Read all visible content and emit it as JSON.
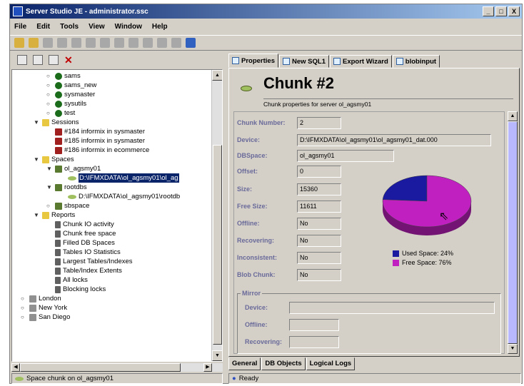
{
  "window": {
    "title": "Server Studio JE - administrator.ssc",
    "buttons": [
      "_",
      "□",
      "X"
    ]
  },
  "menu": [
    "File",
    "Edit",
    "Tools",
    "View",
    "Window",
    "Help"
  ],
  "tree": {
    "items": [
      {
        "label": "sams",
        "icon": "db-icon",
        "indent": 3
      },
      {
        "label": "sams_new",
        "icon": "db-icon",
        "indent": 3
      },
      {
        "label": "sysmaster",
        "icon": "db-icon",
        "indent": 3
      },
      {
        "label": "sysutils",
        "icon": "db-icon",
        "indent": 3
      },
      {
        "label": "test",
        "icon": "db-icon",
        "indent": 3
      },
      {
        "label": "Sessions",
        "icon": "folder-icon",
        "indent": 2
      },
      {
        "label": "#184 informix in sysmaster",
        "icon": "session-icon",
        "indent": 3
      },
      {
        "label": "#185 informix in sysmaster",
        "icon": "session-icon",
        "indent": 3
      },
      {
        "label": "#186 informix in ecommerce",
        "icon": "session-icon",
        "indent": 3
      },
      {
        "label": "Spaces",
        "icon": "folder-icon",
        "indent": 2
      },
      {
        "label": "ol_agsmy01",
        "icon": "dbspace-icon",
        "indent": 3
      },
      {
        "label": "D:\\IFMXDATA\\ol_agsmy01\\ol_ag",
        "icon": "chunk-icon",
        "indent": 4,
        "selected": true
      },
      {
        "label": "rootdbs",
        "icon": "dbspace-icon",
        "indent": 3
      },
      {
        "label": "D:\\IFMXDATA\\ol_agsmy01\\rootdb",
        "icon": "chunk-icon",
        "indent": 4
      },
      {
        "label": "sbspace",
        "icon": "dbspace-icon",
        "indent": 3
      },
      {
        "label": "Reports",
        "icon": "folder-icon",
        "indent": 2
      },
      {
        "label": "Chunk IO activity",
        "icon": "report-icon",
        "indent": 3
      },
      {
        "label": "Chunk free space",
        "icon": "report-icon",
        "indent": 3
      },
      {
        "label": "Filled DB Spaces",
        "icon": "report-icon",
        "indent": 3
      },
      {
        "label": "Tables IO Statistics",
        "icon": "report-icon",
        "indent": 3
      },
      {
        "label": "Largest Tables/Indexes",
        "icon": "report-icon",
        "indent": 3
      },
      {
        "label": "Table/Index Extents",
        "icon": "report-icon",
        "indent": 3
      },
      {
        "label": "All locks",
        "icon": "report-icon",
        "indent": 3
      },
      {
        "label": "Blocking locks",
        "icon": "report-icon",
        "indent": 3
      },
      {
        "label": "London",
        "icon": "server-icon",
        "indent": 1
      },
      {
        "label": "New York",
        "icon": "server-icon",
        "indent": 1
      },
      {
        "label": "San Diego",
        "icon": "server-icon",
        "indent": 1
      }
    ]
  },
  "left_status": "Space chunk on ol_agsmy01",
  "tabs": [
    "Properties",
    "New SQL1",
    "Export Wizard",
    "blobinput"
  ],
  "header": {
    "title": "Chunk #2",
    "subtitle": "Chunk properties for server ol_agsmy01"
  },
  "fields": {
    "chunk_number": {
      "label": "Chunk Number:",
      "value": "2"
    },
    "device": {
      "label": "Device:",
      "value": "D:\\IFMXDATA\\ol_agsmy01\\ol_agsmy01_dat.000"
    },
    "dbspace": {
      "label": "DBSpace:",
      "value": "ol_agsmy01"
    },
    "offset": {
      "label": "Offset:",
      "value": "0"
    },
    "size": {
      "label": "Size:",
      "value": "15360"
    },
    "free_size": {
      "label": "Free Size:",
      "value": "11611"
    },
    "offline": {
      "label": "Offline:",
      "value": "No"
    },
    "recovering": {
      "label": "Recovering:",
      "value": "No"
    },
    "inconsistent": {
      "label": "Inconsistent:",
      "value": "No"
    },
    "blob_chunk": {
      "label": "Blob Chunk:",
      "value": "No"
    }
  },
  "mirror": {
    "title": "Mirror",
    "device_label": "Device:",
    "offline_label": "Offline:",
    "recovering_label": "Recovering:"
  },
  "pie": {
    "used_label": "Used Space: 24%",
    "free_label": "Free Space: 76%",
    "used_fraction": 0.24,
    "used_color": "#1a1aa0",
    "free_color": "#c020c0"
  },
  "bottom_tabs": [
    "General",
    "DB Objects",
    "Logical Logs"
  ],
  "right_status": "Ready"
}
